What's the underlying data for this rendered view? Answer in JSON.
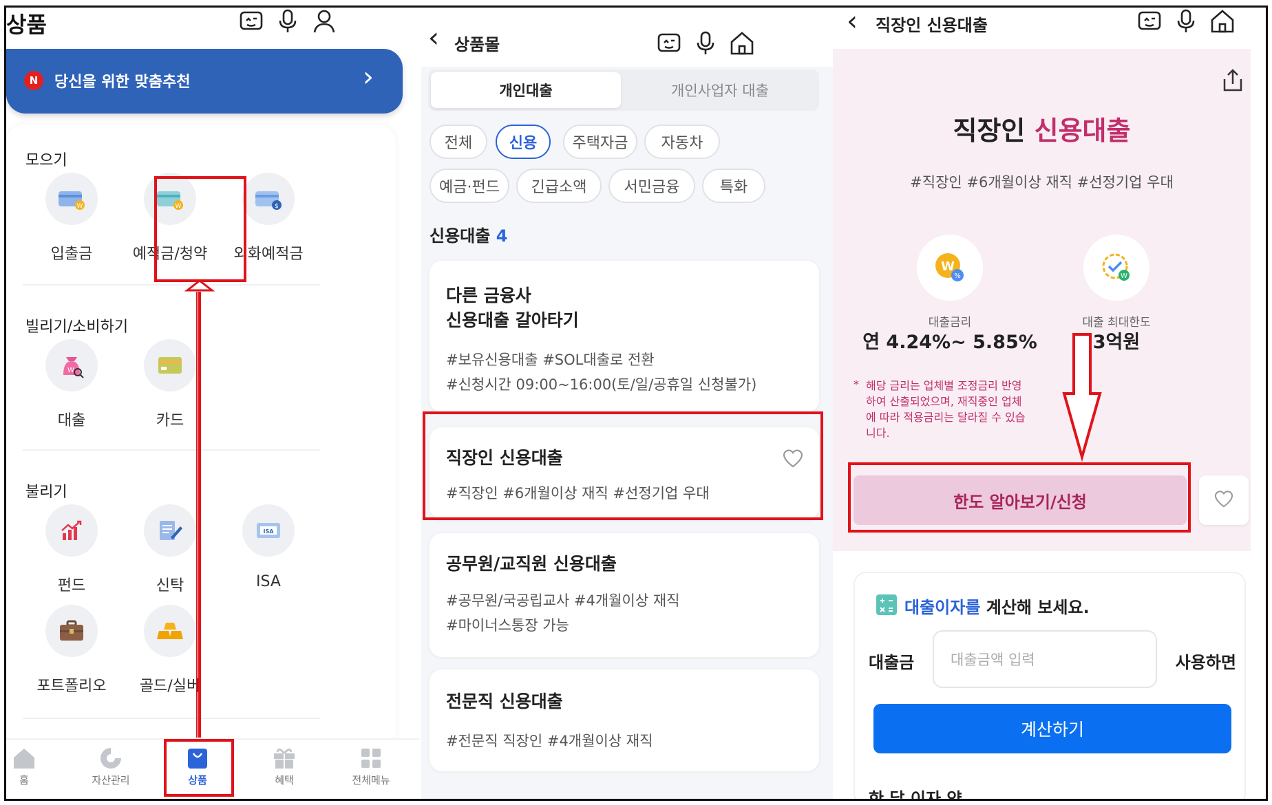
{
  "panel1": {
    "title": "상품",
    "recommend": {
      "badge": "N",
      "text": "당신을 위한 맞춤추천",
      "arrow": "›"
    },
    "sections": [
      {
        "title": "모으기",
        "items": [
          {
            "label": "입출금",
            "icon": "wallet-coin-icon"
          },
          {
            "label": "예적금/청약",
            "icon": "savings-coin-icon"
          },
          {
            "label": "외화예적금",
            "icon": "dollar-card-icon"
          }
        ]
      },
      {
        "title": "빌리기/소비하기",
        "items": [
          {
            "label": "대출",
            "icon": "loan-bag-icon"
          },
          {
            "label": "카드",
            "icon": "credit-card-icon"
          }
        ]
      },
      {
        "title": "불리기",
        "items": [
          {
            "label": "펀드",
            "icon": "fund-chart-icon"
          },
          {
            "label": "신탁",
            "icon": "trust-document-icon"
          },
          {
            "label": "ISA",
            "icon": "isa-card-icon"
          },
          {
            "label": "포트폴리오",
            "icon": "briefcase-icon"
          },
          {
            "label": "골드/실버",
            "icon": "gold-bar-icon"
          }
        ]
      }
    ],
    "tabbar": [
      {
        "label": "홈",
        "icon": "home-icon"
      },
      {
        "label": "자산관리",
        "icon": "pie-chart-icon"
      },
      {
        "label": "상품",
        "icon": "shopping-bag-icon",
        "active": true
      },
      {
        "label": "혜택",
        "icon": "gift-icon"
      },
      {
        "label": "전체메뉴",
        "icon": "grid-menu-icon"
      }
    ]
  },
  "panel2": {
    "back": "‹",
    "title": "상품몰",
    "seg_tabs": [
      "개인대출",
      "개인사업자 대출"
    ],
    "chips_row1": [
      "전체",
      "신용",
      "주택자금",
      "자동차"
    ],
    "chips_row2": [
      "예금·펀드",
      "긴급소액",
      "서민금융",
      "특화"
    ],
    "active_chip": "신용",
    "count_label": "신용대출",
    "count_value": "4",
    "cards": [
      {
        "title1": "다른 금융사",
        "title2": "신용대출 갈아타기",
        "tags1": "#보유신용대출   #SOL대출로 전환",
        "tags2": "#신청시간 09:00~16:00(토/일/공휴일 신청불가)"
      },
      {
        "title1": "직장인 신용대출",
        "tags1": "#직장인   #6개월이상 재직   #선정기업 우대"
      },
      {
        "title1": "공무원/교직원 신용대출",
        "tags1": "#공무원/국공립교사   #4개월이상 재직",
        "tags2": "#마이너스통장 가능"
      },
      {
        "title1": "전문직 신용대출",
        "tags1": "#전문직 직장인   #4개월이상 재직"
      }
    ]
  },
  "panel3": {
    "back": "‹",
    "header_title": "직장인 신용대출",
    "hero_title_prefix": "직장인",
    "hero_title_accent": "신용대출",
    "hashtags": "#직장인   #6개월이상 재직   #선정기업 우대",
    "rate_label": "대출금리",
    "rate_value": "연 4.24%~ 5.85%",
    "limit_label": "대출 최대한도",
    "limit_value": "3억원",
    "note_star": "*",
    "note_lines": [
      "해당 금리는 업체별 조정금리 반영",
      "하여 산출되었으며, 재직중인 업체",
      "에 따라 적용금리는 달라질 수 있습",
      "니다."
    ],
    "apply_button": "한도 알아보기/신청",
    "calc_title_accent": "대출이자를",
    "calc_title_rest": " 계산해 보세요.",
    "amount_label": "대출금",
    "amount_placeholder": "대출금액 입력",
    "amount_suffix": "사용하면",
    "calc_button": "계산하기",
    "cut_text": "한 달 이자 약"
  },
  "colors": {
    "brand_blue": "#2f63b8",
    "accent_blue": "#0a6ff0",
    "pink_accent": "#c22e6b",
    "highlight_red": "#e0131a"
  }
}
